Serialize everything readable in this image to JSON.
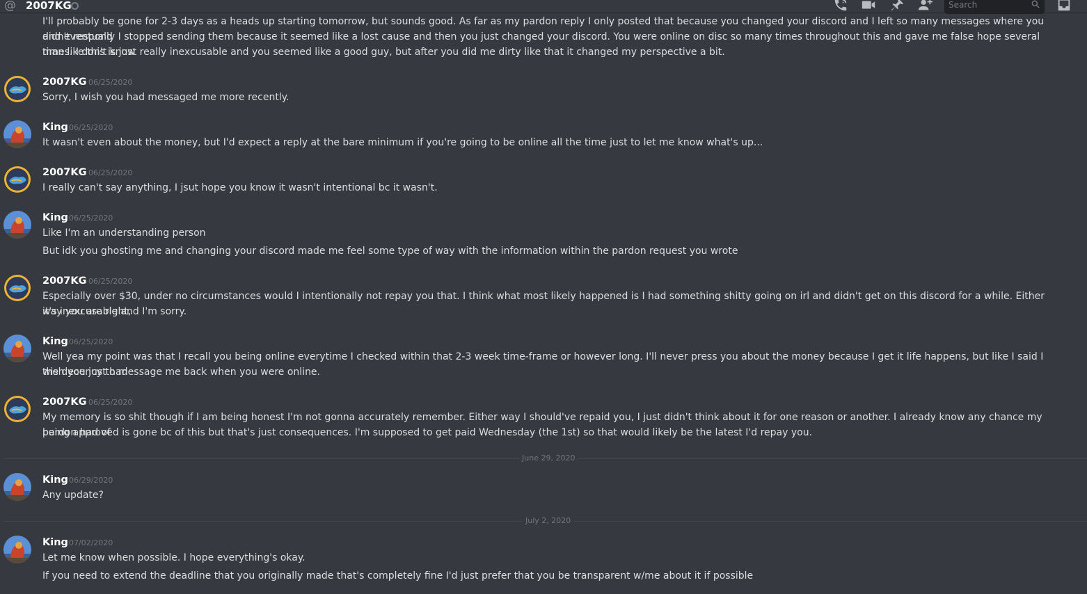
{
  "header": {
    "channel_name": "2007KG",
    "search_placeholder": "Search",
    "icons": [
      "at-icon",
      "status-offline-icon",
      "call-icon",
      "video-icon",
      "pin-icon",
      "add-friend-icon",
      "search-icon",
      "inbox-icon"
    ]
  },
  "messages": [
    {
      "id": "m0",
      "author": "",
      "timestamp": "",
      "lines": [
        "I'll probably be gone for 2-3 days as a heads up starting tomorrow, but sounds good. As far as my pardon reply I only posted that because you changed your discord and I left so many messages where you didn't respond",
        "and eventually I stopped sending them because it seemed like a lost cause and then you just changed your discord. You were online on disc so many times throughout this and gave me false hope several times. I don't know",
        "man like this is just really inexcusable and you seemed like a good guy, but after you did me dirty like that it changed my perspective a bit."
      ]
    },
    {
      "id": "m1",
      "author": "2007KG",
      "timestamp": "06/25/2020",
      "lines": [
        "Sorry, I wish you had messaged me more recently."
      ]
    },
    {
      "id": "m2",
      "author": "King",
      "timestamp": "06/25/2020",
      "lines": [
        "It wasn't even about the money, but I'd expect a reply at the bare minimum if you're going to be online all the time just to let me know what's up..."
      ]
    },
    {
      "id": "m3",
      "author": "2007KG",
      "timestamp": "06/25/2020",
      "lines": [
        "I really can't say anything, I jsut hope you know it wasn't intentional bc it wasn't."
      ]
    },
    {
      "id": "m4",
      "author": "King",
      "timestamp": "06/25/2020",
      "lines": [
        "Like I'm an understanding person",
        "But idk you ghosting me and changing your discord made me feel some type of way with the information within the pardon request you wrote"
      ]
    },
    {
      "id": "m5",
      "author": "2007KG",
      "timestamp": "06/25/2020",
      "lines": [
        "Especially over $30, under no circumstances would I intentionally not repay you that. I think what most likely happened is I had something shitty going on irl and didn't get on this discord for a while. Either way you are right,",
        "it's inexcusable and I'm sorry."
      ]
    },
    {
      "id": "m6",
      "author": "King",
      "timestamp": "06/25/2020",
      "lines": [
        "Well yea my point was that I recall you being online everytime I checked within that 2-3 week time-frame or however long. I'll never press you about the money because I get it life happens, but like I said I wish you just had",
        "the decency to message me back when you were online."
      ]
    },
    {
      "id": "m7",
      "author": "2007KG",
      "timestamp": "06/25/2020",
      "lines": [
        "My memory is so shit though if I am being honest I'm not gonna accurately remember. Either way I should've repaid you, I just didn't think about it for one reason or another. I already know any chance my pardon had of",
        "being approved is gone bc of this but that's just consequences. I'm supposed to get paid Wednesday (the 1st) so that would likely be the latest I'd repay you."
      ]
    },
    {
      "id": "m8",
      "author": "King",
      "timestamp": "06/29/2020",
      "lines": [
        "Any update?"
      ]
    },
    {
      "id": "m9",
      "author": "King",
      "timestamp": "07/02/2020",
      "lines": [
        "Let me know when possible. I hope everything's okay.",
        "If you need to extend the deadline that you originally made that's completely fine I'd just prefer that you be transparent w/me about it if possible"
      ]
    }
  ],
  "dividers": [
    "June 29, 2020",
    "July 2, 2020"
  ],
  "colors": {
    "background": "#36393f",
    "text": "#dcddde",
    "timestamp": "#72767d",
    "author": "#ffffff",
    "kg_avatar_ring": "#f0b232",
    "kg_avatar_bg": "#2c3a5c",
    "king_avatar_sky": "#5b8fd6"
  }
}
